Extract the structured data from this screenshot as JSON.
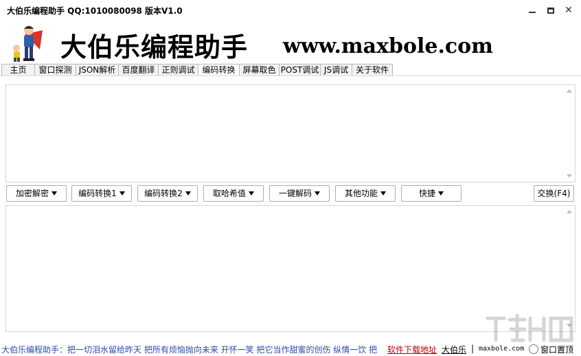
{
  "window": {
    "title": "大伯乐编程助手 QQ:1010080098  版本V1.0"
  },
  "banner": {
    "brand": "大伯乐编程助手",
    "website": "www.maxbole.com",
    "mascot_icon": "superhero-mascot-icon"
  },
  "tabs": [
    {
      "label": "主页"
    },
    {
      "label": "窗口探测"
    },
    {
      "label": "JSON解析"
    },
    {
      "label": "百度翻译"
    },
    {
      "label": "正则调试"
    },
    {
      "label": "编码转换",
      "active": true
    },
    {
      "label": "屏幕取色"
    },
    {
      "label": "POST调试"
    },
    {
      "label": "JS调试"
    },
    {
      "label": "关于软件"
    }
  ],
  "input_text": "",
  "output_text": "",
  "buttons": {
    "encrypt": "加密解密",
    "encode1": "编码转换1",
    "encode2": "编码转换2",
    "hash": "取哈希值",
    "decode": "一键解码",
    "other": "其他功能",
    "quick": "快捷",
    "swap": "交换(F4)"
  },
  "status": {
    "slogan": "大伯乐编程助手：把一切泪水留给昨天  把所有烦恼抛向未来  开怀一笑  把它当作甜蜜的创伤  纵情一饮  把",
    "download_link": "软件下载地址",
    "author_link": "大伯乐",
    "separator": "|",
    "domain": "maxbole.com",
    "topmost_label": "窗口置顶",
    "topmost_checked": false
  },
  "colors": {
    "slogan": "#2c4ab0",
    "download_link": "#c00000"
  }
}
